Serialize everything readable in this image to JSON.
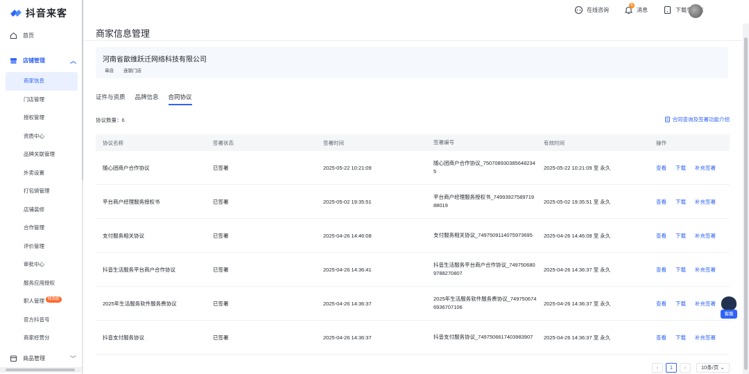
{
  "app": {
    "logo_text": "抖音来客"
  },
  "header": {
    "consult_label": "在线咨询",
    "messages_label": "消息",
    "messages_badge": "6",
    "download_label": "下载手机端"
  },
  "sidebar": {
    "home_label": "首页",
    "section_label": "店铺管理",
    "items": [
      {
        "label": "商家信息",
        "active": true
      },
      {
        "label": "门店管理"
      },
      {
        "label": "授权管理"
      },
      {
        "label": "资质中心"
      },
      {
        "label": "品牌关联管理"
      },
      {
        "label": "外卖设置"
      },
      {
        "label": "打包袋管理"
      },
      {
        "label": "店铺装修"
      },
      {
        "label": "合作管理"
      },
      {
        "label": "评价管理"
      },
      {
        "label": "审批中心"
      },
      {
        "label": "服务应用授权"
      },
      {
        "label": "职人管理",
        "tag": "修改版"
      },
      {
        "label": "官方抖音号"
      },
      {
        "label": "商家经营分"
      }
    ],
    "bottom_label": "商品管理"
  },
  "page": {
    "title": "商家信息管理",
    "merchant_name": "河南省歆维跃迁网络科技有限公司",
    "merchant_tags": [
      "单店",
      "连锁门店"
    ],
    "tabs": [
      "证件与资质",
      "品牌信息",
      "合同协议"
    ],
    "active_tab": 2,
    "count_text": "协议数量：6",
    "help_link": "合同查询及签署功能介绍"
  },
  "table": {
    "headers": [
      "协议名称",
      "签署状态",
      "签署时间",
      "签署编号",
      "有效时间",
      "操作"
    ],
    "rows": [
      {
        "name": "随心团商户合作协议",
        "status": "已签署",
        "time": "2025-05-22 10:21:09",
        "code": "随心团商户合作协议_7507089303856482345",
        "valid": "2025-05-22 10:21:09 至 永久"
      },
      {
        "name": "平台商户经理服务授权书",
        "status": "已签署",
        "time": "2025-05-02 19:35:51",
        "code": "平台商户经理服务授权书_7499392758971988019",
        "valid": "2025-05-02 19:35:51 至 永久"
      },
      {
        "name": "支付服务相关协议",
        "status": "已签署",
        "time": "2025-04-26 14:46:08",
        "code": "支付服务相关协议_7497509114075973695",
        "valid": "2025-04-26 14:46:08 至 永久"
      },
      {
        "name": "抖音生活服务平台商户合作协议",
        "status": "已签署",
        "time": "2025-04-26 14:36:41",
        "code": "抖音生活服务平台商户合作协议_7497506809788270807",
        "valid": "2025-04-26 14:36:37 至 永久"
      },
      {
        "name": "2025年生活服务软件服务费协议",
        "status": "已签署",
        "time": "2025-04-26 14:36:37",
        "code": "2025年生活服务软件服务费协议_7497506746936707106",
        "valid": "2025-04-26 14:36:37 至 永久"
      },
      {
        "name": "抖音支付服务协议",
        "status": "已签署",
        "time": "2025-04-26 14:36:37",
        "code": "抖音支付服务协议_7497506617403983907",
        "valid": "2025-04-26 14:36:37 至 永久"
      }
    ],
    "ops": [
      "查看",
      "下载",
      "补充签署"
    ]
  },
  "pagination": {
    "current": "1",
    "page_size": "10条/页"
  },
  "float_helper": {
    "label": "客服"
  },
  "colors": {
    "accent": "#2e63f5",
    "badge": "#ff8f1f",
    "tag": "#ff6a2f"
  }
}
